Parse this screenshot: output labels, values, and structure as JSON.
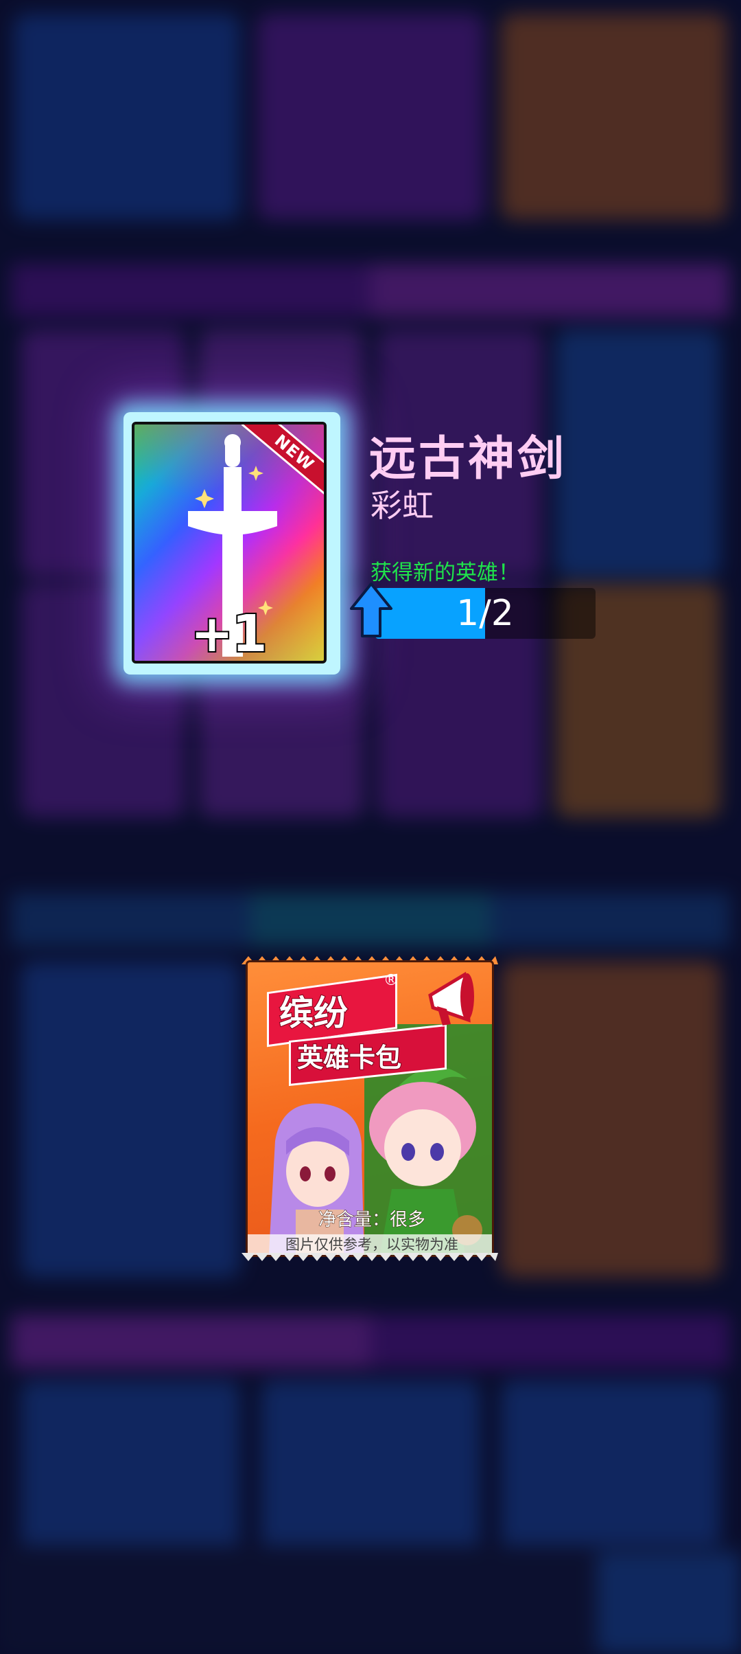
{
  "reward": {
    "item_name": "远古神剑",
    "rarity": "彩虹",
    "new_badge": "NEW",
    "quantity_label": "+1",
    "new_hero_text": "获得新的英雄！",
    "progress_text": "1/2",
    "progress_fraction": 0.5
  },
  "pack": {
    "brand": "缤纷",
    "registered_mark": "®",
    "subtitle": "英雄卡包",
    "net_content": "净含量：很多",
    "disclaimer": "图片仅供参考，以实物为准"
  },
  "colors": {
    "name_color": "#ffcdf3",
    "new_hero_color": "#1fe24b",
    "progress_color": "#08a2ff"
  }
}
